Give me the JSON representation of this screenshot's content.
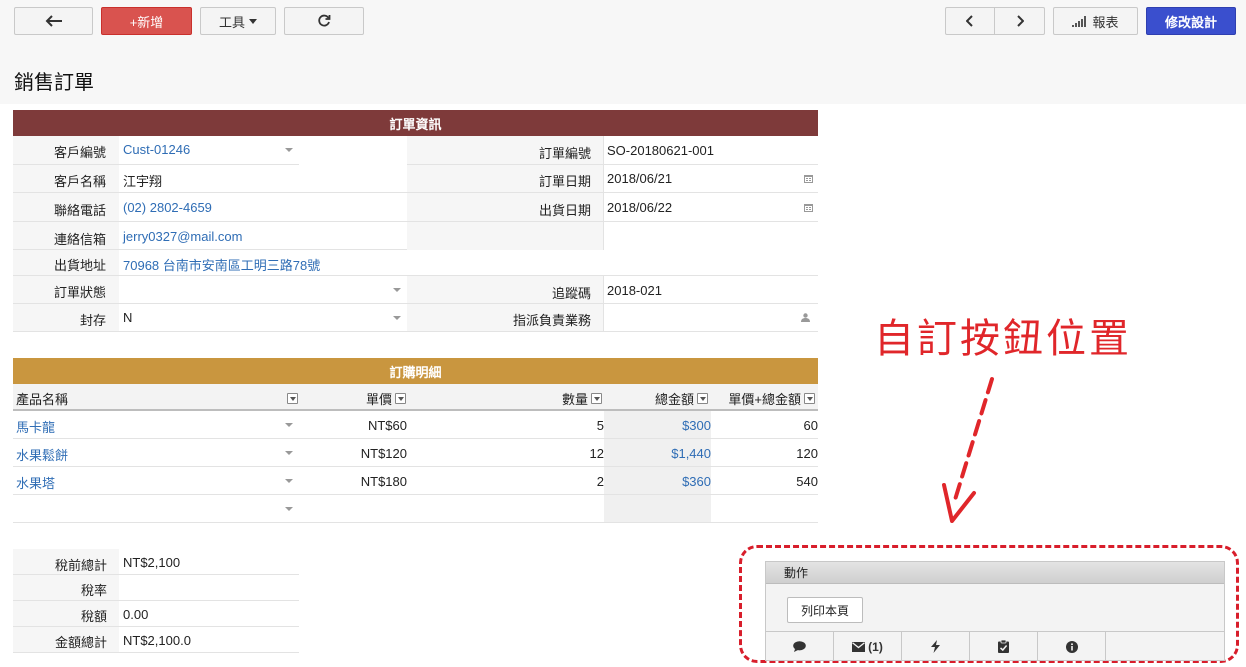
{
  "toolbar": {
    "new_label": "+新增",
    "tools_label": "工具",
    "report_label": "報表",
    "edit_design_label": "修改設計"
  },
  "page": {
    "title": "銷售訂單"
  },
  "order_info": {
    "section_title": "訂單資訊",
    "customer_id_label": "客戶編號",
    "customer_id": "Cust-01246",
    "customer_name_label": "客戶名稱",
    "customer_name": "江宇翔",
    "phone_label": "聯絡電話",
    "phone": "(02) 2802-4659",
    "email_label": "連絡信箱",
    "email": "jerry0327@mail.com",
    "address_label": "出貨地址",
    "address": "70968 台南市安南區工明三路78號",
    "status_label": "訂單狀態",
    "status": "",
    "archive_label": "封存",
    "archive": "N",
    "order_no_label": "訂單編號",
    "order_no": "SO-20180621-001",
    "order_date_label": "訂單日期",
    "order_date": "2018/06/21",
    "ship_date_label": "出貨日期",
    "ship_date": "2018/06/22",
    "tracking_label": "追蹤碼",
    "tracking": "2018-021",
    "assignee_label": "指派負責業務",
    "assignee": ""
  },
  "order_details": {
    "section_title": "訂購明細",
    "columns": {
      "product": "產品名稱",
      "unit_price": "單價",
      "quantity": "數量",
      "total": "總金額",
      "price_plus_total": "單價+總金額"
    },
    "rows": [
      {
        "product": "馬卡龍",
        "unit_price": "NT$60",
        "quantity": "5",
        "total": "$300",
        "price_plus_total": "60"
      },
      {
        "product": "水果鬆餅",
        "unit_price": "NT$120",
        "quantity": "12",
        "total": "$1,440",
        "price_plus_total": "120"
      },
      {
        "product": "水果塔",
        "unit_price": "NT$180",
        "quantity": "2",
        "total": "$360",
        "price_plus_total": "540"
      }
    ]
  },
  "summary": {
    "subtotal_label": "稅前總計",
    "subtotal": "NT$2,100",
    "tax_rate_label": "稅率",
    "tax_rate": "",
    "tax_label": "稅額",
    "tax": "0.00",
    "total_label": "金額總計",
    "total": "NT$2,100.0"
  },
  "annotation": {
    "text": "自訂按鈕位置",
    "color": "#e0262a"
  },
  "action_panel": {
    "title": "動作",
    "print_label": "列印本頁",
    "mail_count": "(1)"
  },
  "colors": {
    "maroon_header": "#7e3a3a",
    "gold_header": "#c9963f",
    "new_button": "#d9534f",
    "edit_button": "#3a4fce",
    "link": "#2f6db5"
  }
}
